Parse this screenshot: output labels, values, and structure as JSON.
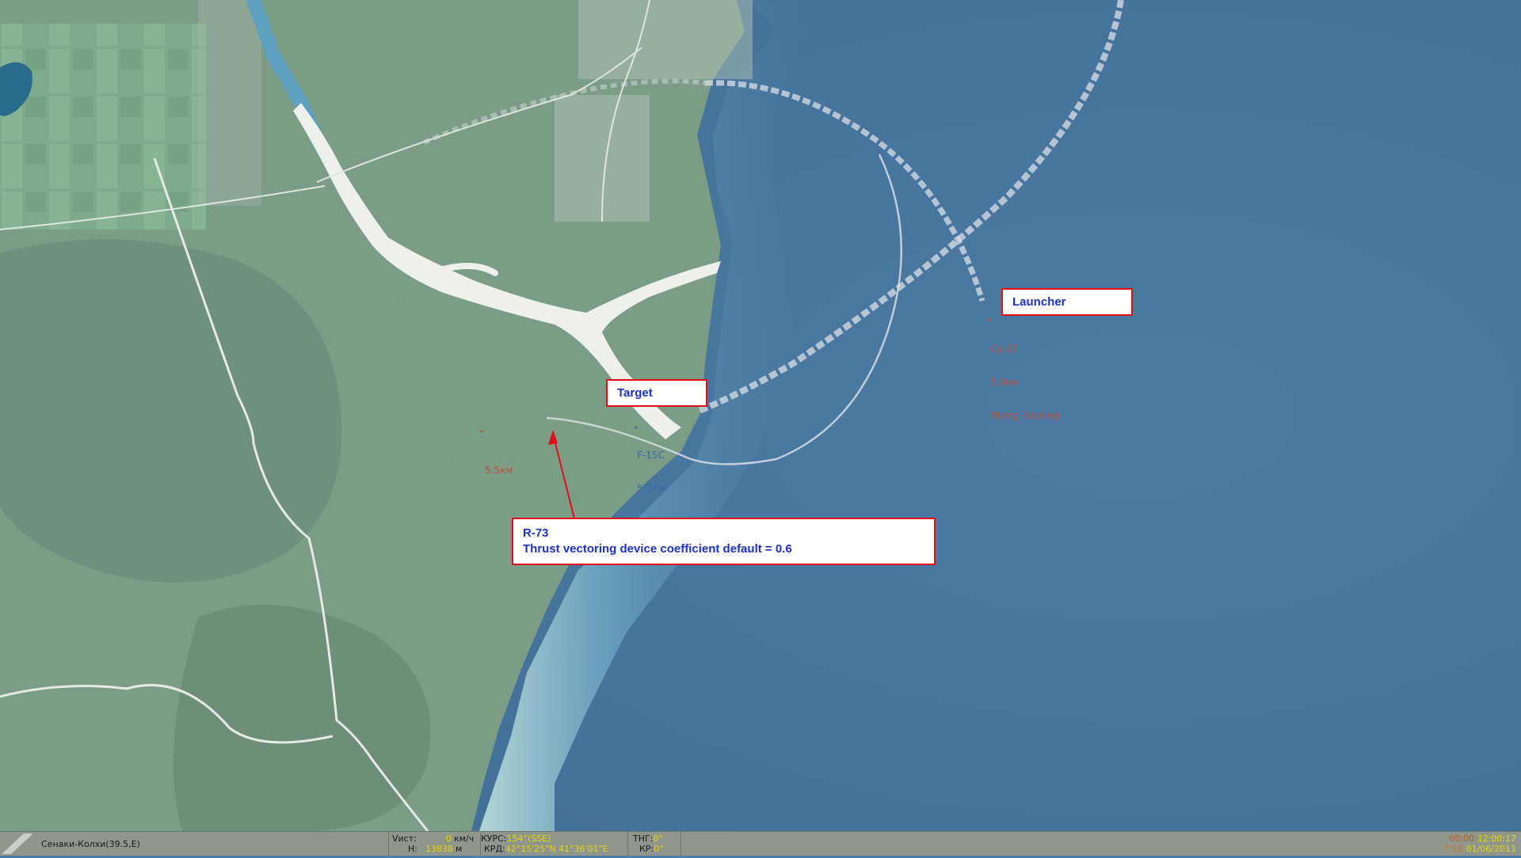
{
  "map": {
    "units": {
      "launcher_unit": {
        "name": "Су-27",
        "distance": "5.9км",
        "subtitle": "Flying Booking",
        "color": "#b5523f"
      },
      "target_unit": {
        "name": "F-15C",
        "distance": "5.2км",
        "color": "#3b6aa8"
      },
      "missile": {
        "distance": "5.5км",
        "color": "#b5523f"
      }
    }
  },
  "callouts": {
    "launcher": "Launcher",
    "target": "Target",
    "missile_title": "R-73",
    "missile_desc": "Thrust vectoring device coefficient default = 0.6"
  },
  "statusbar": {
    "location": "Сенаки-Колхи(39.5,E)",
    "speed_label": "Vист:",
    "speed_value": "0",
    "speed_unit": "км/ч",
    "alt_label": "H:",
    "alt_value": "13838",
    "alt_unit": "м",
    "course_label": "КУРС:",
    "course_value": "154°(SSE)",
    "coord_label": "КРД:",
    "coord_value": "42°15'25\"N 41°36'01\"E",
    "pitch_label": "ТНГ:",
    "pitch_value": "0°",
    "roll_label": "КР:",
    "roll_value": "0°",
    "time_prefix": "00:00",
    "time_value": "12:00:17",
    "date_prefix": "T 11",
    "date_value": "01/06/2011"
  },
  "colors": {
    "sea": "#4e7ca2",
    "land": "#7fa08a",
    "callout_border": "#e0101a",
    "callout_text": "#1d31c8",
    "arrow": "#e0101a",
    "status_value": "#e8d20c"
  }
}
